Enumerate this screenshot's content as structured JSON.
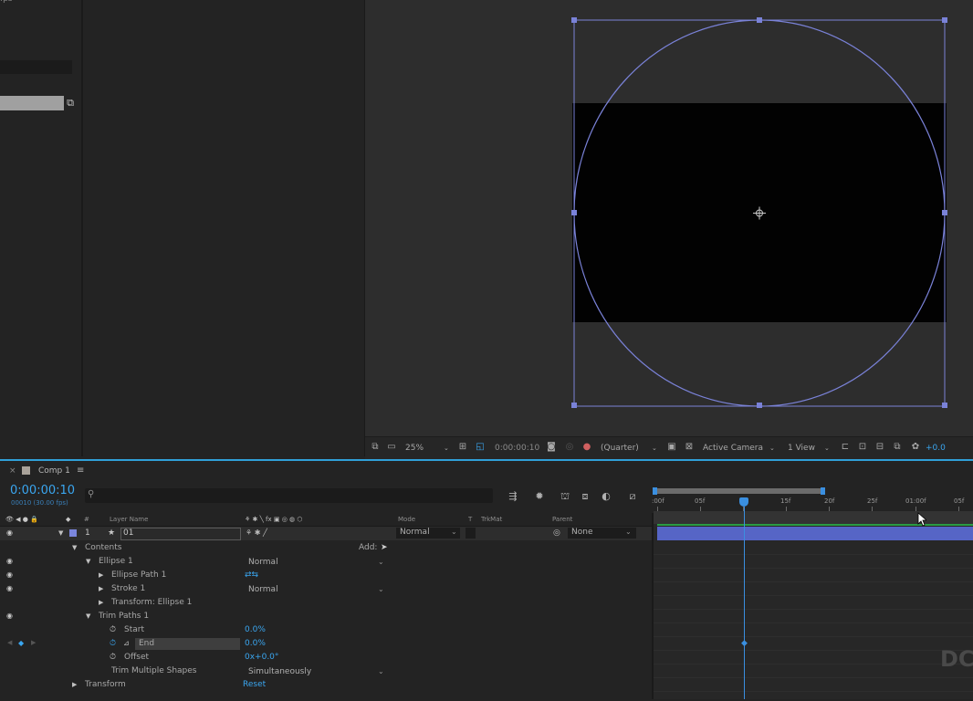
{
  "project": {
    "fps_label": "fps"
  },
  "viewer": {
    "zoom": "25%",
    "timecode": "0:00:00:10",
    "resolution": "(Quarter)",
    "camera": "Active Camera",
    "views": "1 View",
    "exposure": "+0.0"
  },
  "timeline": {
    "tab_label": "Comp 1",
    "timecode": "0:00:00:10",
    "frames": "00010 (30.00 fps)",
    "ruler_ticks": [
      ":00f",
      "05f",
      "10f",
      "15f",
      "20f",
      "25f",
      "01:00f",
      "05f"
    ],
    "columns": {
      "layer_num": "#",
      "layer_name": "Layer Name",
      "mode": "Mode",
      "t": "T",
      "trkmat": "TrkMat",
      "parent": "Parent"
    },
    "layer": {
      "number": "1",
      "name": "01",
      "mode": "Normal",
      "parent": "None"
    },
    "properties": {
      "contents": "Contents",
      "add": "Add:",
      "ellipse_1": "Ellipse 1",
      "ellipse_1_mode": "Normal",
      "ellipse_path": "Ellipse Path 1",
      "stroke": "Stroke 1",
      "stroke_mode": "Normal",
      "transform_ellipse": "Transform: Ellipse 1",
      "trim_paths": "Trim Paths 1",
      "start": "Start",
      "start_value": "0.0%",
      "end": "End",
      "end_value": "0.0%",
      "offset": "Offset",
      "offset_value": "0x+0.0°",
      "trim_multiple": "Trim Multiple Shapes",
      "trim_multiple_value": "Simultaneously",
      "transform": "Transform",
      "reset": "Reset"
    }
  },
  "watermark": "DC"
}
